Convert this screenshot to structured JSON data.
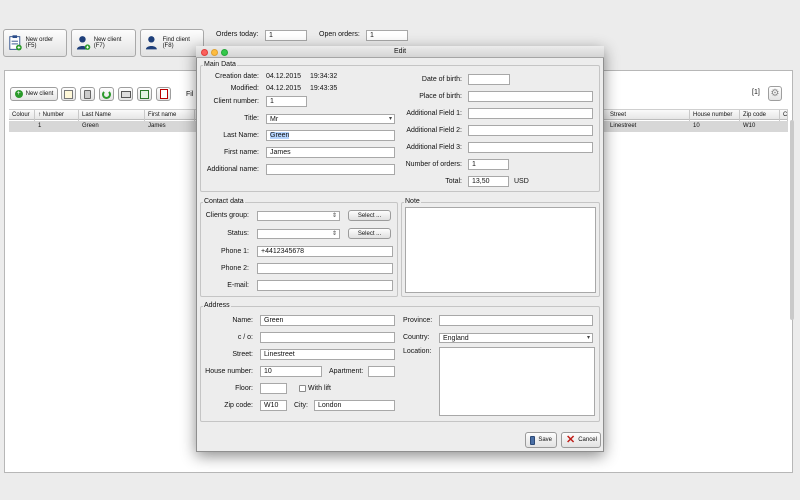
{
  "toolbar": {
    "new_order": "New order (F5)",
    "new_client": "New client (F7)",
    "find_client": "Find client (F8)",
    "orders_today_label": "Orders today:",
    "orders_today_value": "1",
    "open_orders_label": "Open orders:",
    "open_orders_value": "1"
  },
  "client_list": {
    "new_client_button": "New client",
    "filter_partial": "Fil",
    "page_indicator": "[1]",
    "columns": [
      "Colour",
      "↑ Number",
      "Last Name",
      "First name",
      "Street",
      "House number",
      "Zip code",
      "C"
    ],
    "row": {
      "number": "1",
      "last_name": "Green",
      "first_name": "James",
      "street": "Linestreet",
      "house_number": "10",
      "zip_code": "W10"
    }
  },
  "dialog": {
    "title": "Edit",
    "main_data": {
      "group_title": "Main Data",
      "creation_date_label": "Creation date:",
      "creation_date": "04.12.2015",
      "creation_time": "19:34:32",
      "modified_label": "Modified:",
      "modified_date": "04.12.2015",
      "modified_time": "19:43:35",
      "client_number_label": "Client number:",
      "client_number": "1",
      "title_label": "Title:",
      "title_value": "Mr",
      "last_name_label": "Last Name:",
      "last_name": "Green",
      "first_name_label": "First name:",
      "first_name": "James",
      "additional_name_label": "Additional name:",
      "additional_name": "",
      "dob_label": "Date of birth:",
      "dob": "",
      "pob_label": "Place of birth:",
      "pob": "",
      "af1_label": "Additional Field 1:",
      "af2_label": "Additional Field 2:",
      "af3_label": "Additional Field 3:",
      "orders_label": "Number of orders:",
      "orders": "1",
      "total_label": "Total:",
      "total": "13,50",
      "currency": "USD"
    },
    "contact": {
      "group_title": "Contact data",
      "clients_group_label": "Clients group:",
      "status_label": "Status:",
      "select_label": "Select ...",
      "phone1_label": "Phone 1:",
      "phone1": "+4412345678",
      "phone2_label": "Phone 2:",
      "email_label": "E-mail:"
    },
    "note": {
      "group_title": "Note"
    },
    "address": {
      "group_title": "Address",
      "name_label": "Name:",
      "name": "Green",
      "co_label": "c / o:",
      "street_label": "Street:",
      "street": "Linestreet",
      "house_label": "House number:",
      "house": "10",
      "apartment_label": "Apartment:",
      "floor_label": "Floor:",
      "lift_label": "With lift",
      "zip_label": "Zip code:",
      "zip": "W10",
      "city_label": "City:",
      "city": "London",
      "province_label": "Province:",
      "country_label": "Country:",
      "country": "England",
      "location_label": "Location:"
    },
    "save": "Save",
    "cancel": "Cancel"
  },
  "colors": {
    "selection": "#b5d5ff",
    "row_highlight": "#d7d7d7"
  }
}
